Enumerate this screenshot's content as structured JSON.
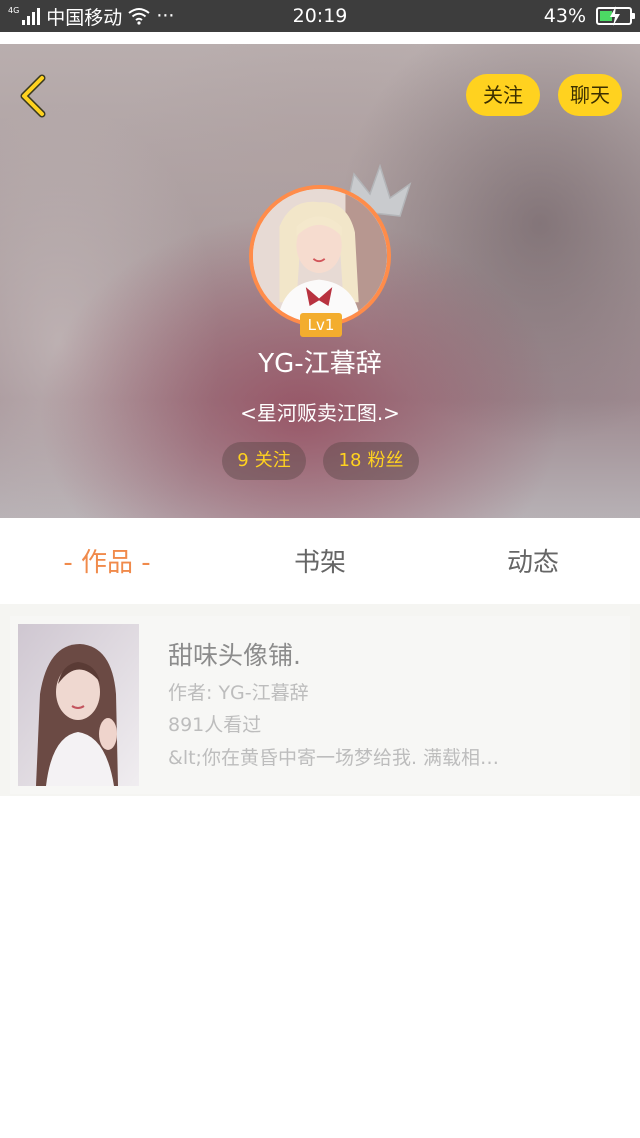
{
  "status_bar": {
    "network": "4G",
    "carrier": "中国移动",
    "dots": "···",
    "time": "20:19",
    "battery": "43%",
    "battery_level": 0.43,
    "icons": [
      "signal-icon",
      "wifi-icon",
      "battery-charging-icon"
    ]
  },
  "header": {
    "follow_label": "关注",
    "chat_label": "聊天",
    "level": "Lv1",
    "username": "YG-江暮辞",
    "signature": "<星河贩卖江图.>",
    "following_count": "9",
    "following_label": "关注",
    "fans_count": "18",
    "fans_label": "粉丝",
    "colors": {
      "accent_yellow": "#ffd21f",
      "avatar_ring": "#ff8c4a",
      "level_badge": "#f3ad2e"
    }
  },
  "tabs": {
    "works": "- 作品 -",
    "shelf": "书架",
    "feed": "动态",
    "active": "works",
    "colors": {
      "active": "#f08a4b",
      "inactive": "#666666"
    }
  },
  "works": [
    {
      "title": "甜味头像铺.",
      "author": "作者: YG-江暮辞",
      "views": "891人看过",
      "description": "&lt;你在黄昏中寄一场梦给我. 满载相…"
    }
  ]
}
